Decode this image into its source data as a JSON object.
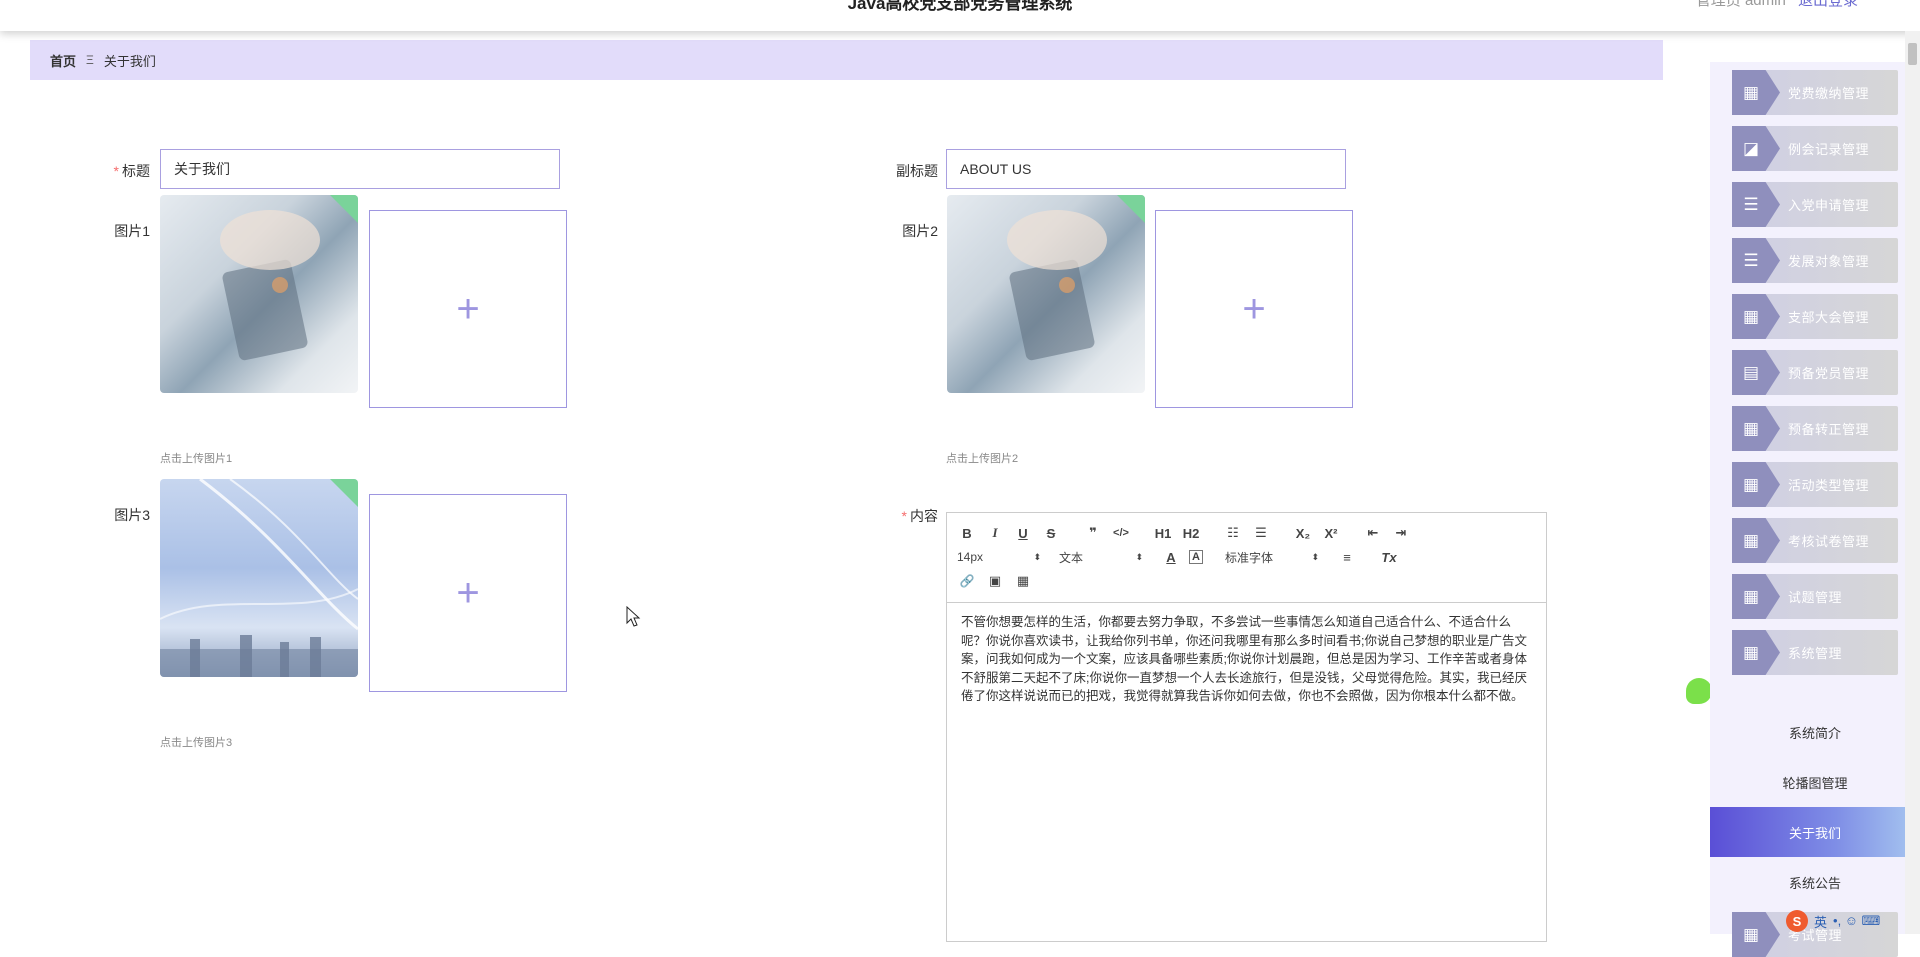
{
  "header": {
    "title": "Java高校党支部党务管理系统",
    "user_text": "管理员 admin",
    "logout": "退出登录"
  },
  "breadcrumb": {
    "home": "首页",
    "separator": "Ξ",
    "current": "关于我们"
  },
  "form": {
    "title_label": "标题",
    "title_value": "关于我们",
    "subtitle_label": "副标题",
    "subtitle_value": "ABOUT US",
    "pic1_label": "图片1",
    "pic1_hint": "点击上传图片1",
    "pic2_label": "图片2",
    "pic2_hint": "点击上传图片2",
    "pic3_label": "图片3",
    "pic3_hint": "点击上传图片3",
    "content_label": "内容",
    "upload_plus": "+"
  },
  "editor": {
    "buttons": {
      "bold": "B",
      "italic": "I",
      "underline": "U",
      "strike": "S",
      "quote": "❞",
      "code": "</>",
      "h1": "H1",
      "h2": "H2",
      "ordered": "☷",
      "bullet": "☰",
      "sub": "X₂",
      "sup": "X²",
      "outdent": "⇤",
      "indent": "⇥",
      "color": "A",
      "background": "A",
      "align": "≡",
      "clean": "Tx",
      "link": "🔗",
      "image": "▣",
      "video": "▦"
    },
    "size_select": "14px",
    "header_select": "文本",
    "font_select": "标准字体",
    "content": "不管你想要怎样的生活，你都要去努力争取，不多尝试一些事情怎么知道自己适合什么、不适合什么呢？你说你喜欢读书，让我给你列书单，你还问我哪里有那么多时间看书;你说自己梦想的职业是广告文案，问我如何成为一个文案，应该具备哪些素质;你说你计划晨跑，但总是因为学习、工作辛苦或者身体不舒服第二天起不了床;你说你一直梦想一个人去长途旅行，但是没钱，父母觉得危险。其实，我已经厌倦了你这样说说而已的把戏，我觉得就算我告诉你如何去做，你也不会照做，因为你根本什么都不做。"
  },
  "sidebar": {
    "menu": [
      {
        "label": "党费缴纳管理",
        "icon": "grid-icon",
        "glyph": "▦"
      },
      {
        "label": "例会记录管理",
        "icon": "chart-icon",
        "glyph": "◪"
      },
      {
        "label": "入党申请管理",
        "icon": "list-icon",
        "glyph": "☰"
      },
      {
        "label": "发展对象管理",
        "icon": "list-icon",
        "glyph": "☰"
      },
      {
        "label": "支部大会管理",
        "icon": "grid-icon",
        "glyph": "▦"
      },
      {
        "label": "预备党员管理",
        "icon": "clipboard-icon",
        "glyph": "▤"
      },
      {
        "label": "预备转正管理",
        "icon": "table-icon",
        "glyph": "▦"
      },
      {
        "label": "活动类型管理",
        "icon": "grid-icon",
        "glyph": "▦"
      },
      {
        "label": "考核试卷管理",
        "icon": "grid-icon",
        "glyph": "▦"
      },
      {
        "label": "试题管理",
        "icon": "grid-icon",
        "glyph": "▦"
      },
      {
        "label": "系统管理",
        "icon": "grid-icon",
        "glyph": "▦"
      }
    ],
    "sub": [
      {
        "label": "系统简介"
      },
      {
        "label": "轮播图管理"
      },
      {
        "label": "关于我们"
      },
      {
        "label": "系统公告"
      }
    ],
    "last_menu": {
      "label": "考试管理",
      "glyph": "▦"
    }
  },
  "ime": {
    "logo": "S",
    "lang": "英",
    "rest": "•, ☺ ⌨"
  }
}
